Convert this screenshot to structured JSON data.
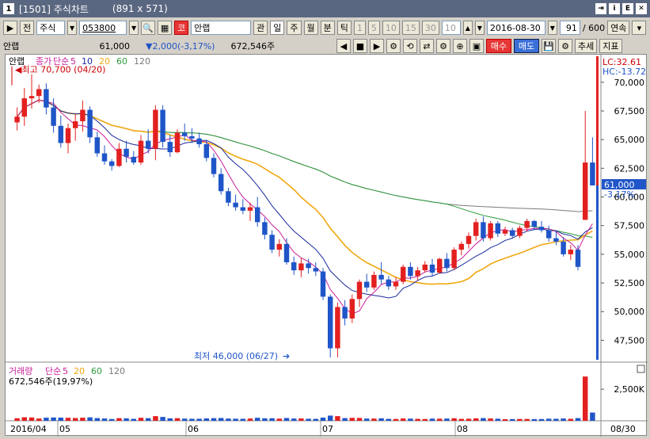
{
  "window": {
    "number": "1",
    "title": "[1501] 주식차트",
    "size": "(891 x 571)"
  },
  "toolbar1": {
    "market_label": "전",
    "market_select": "주식",
    "code": "053800",
    "code_badge": "코",
    "name": "안랩",
    "periods": [
      "관",
      "일",
      "주",
      "월",
      "분",
      "틱"
    ],
    "intervals": [
      "1",
      "5",
      "10",
      "15",
      "30"
    ],
    "interval_value": "10",
    "date": "2016-08-30",
    "count": "91",
    "total": "/ 600",
    "continuous": "연속"
  },
  "toolbar2": {
    "stock_name": "안랩",
    "price": "61,000",
    "change": "▼2,000(-3,17%)",
    "volume": "672,546주",
    "buy": "매수",
    "sell": "매도",
    "trend": "추세",
    "indicator": "지표"
  },
  "price_panel": {
    "legend_name": "안랩",
    "legend_ma": [
      "종가",
      "단순",
      "5",
      "10",
      "20",
      "60",
      "120"
    ],
    "high_marker": "최고 70,700 (04/20)",
    "low_marker": "최저 46,000 (06/27)",
    "lc": "LC:32.61",
    "hc": "HC:-13.72",
    "last_price": "61,000",
    "last_change": "-3.17%"
  },
  "volume_panel": {
    "legend": [
      "거래량",
      "단순",
      "5",
      "20",
      "60",
      "120"
    ],
    "value": "672,546주(19,97%)",
    "axis_label": "2,500K"
  },
  "colors": {
    "up": "#e32020",
    "down": "#1f55c8",
    "ma5": "#c81e9a",
    "ma10": "#1a2a9a",
    "ma20": "#f0a810",
    "ma60": "#2a9a3a",
    "ma120": "#7a7a7a"
  },
  "chart_data": {
    "type": "candlestick",
    "y_ticks": [
      47500,
      50000,
      52500,
      55000,
      57500,
      60000,
      62500,
      65000,
      67500,
      70000
    ],
    "y_labels": [
      "47,500",
      "50,000",
      "52,500",
      "55,000",
      "57,500",
      "60,000",
      "62,500",
      "65,000",
      "67,500",
      "70,000"
    ],
    "ylim": [
      45800,
      71300
    ],
    "x_labels": [
      "2016/04",
      "05",
      "06",
      "07",
      "08",
      "08/30"
    ],
    "candles": [
      [
        66500,
        67800,
        65800,
        67000
      ],
      [
        67000,
        69500,
        66200,
        68600
      ],
      [
        68600,
        70700,
        67700,
        68800
      ],
      [
        68800,
        69800,
        68200,
        69400
      ],
      [
        69400,
        69900,
        67200,
        67800
      ],
      [
        67800,
        68600,
        65600,
        66200
      ],
      [
        66200,
        67100,
        64300,
        64700
      ],
      [
        64700,
        66400,
        63800,
        66000
      ],
      [
        66000,
        67200,
        64900,
        66600
      ],
      [
        66600,
        68400,
        65700,
        67600
      ],
      [
        67600,
        67900,
        64700,
        65200
      ],
      [
        65200,
        65700,
        63500,
        63800
      ],
      [
        63800,
        64500,
        62800,
        63100
      ],
      [
        63100,
        63300,
        62300,
        62700
      ],
      [
        62700,
        64700,
        62600,
        64200
      ],
      [
        64200,
        64900,
        63000,
        63500
      ],
      [
        63500,
        64000,
        62800,
        63000
      ],
      [
        63000,
        65400,
        62800,
        64900
      ],
      [
        64900,
        65900,
        63800,
        64200
      ],
      [
        64200,
        68000,
        63200,
        67600
      ],
      [
        67600,
        68000,
        64300,
        64800
      ],
      [
        64800,
        65400,
        63500,
        63900
      ],
      [
        63900,
        65900,
        63800,
        65600
      ],
      [
        65600,
        66400,
        64900,
        65300
      ],
      [
        65300,
        66000,
        64700,
        65100
      ],
      [
        65100,
        65600,
        64300,
        64600
      ],
      [
        64600,
        64900,
        63100,
        63400
      ],
      [
        63400,
        63800,
        61700,
        62000
      ],
      [
        62000,
        62500,
        60200,
        60500
      ],
      [
        60500,
        60800,
        59200,
        59500
      ],
      [
        59500,
        60200,
        58800,
        59100
      ],
      [
        59100,
        59800,
        58500,
        58800
      ],
      [
        58800,
        59500,
        57900,
        59100
      ],
      [
        59100,
        60000,
        57400,
        57800
      ],
      [
        57800,
        58200,
        56300,
        56700
      ],
      [
        56700,
        57100,
        55100,
        55400
      ],
      [
        55400,
        56300,
        54800,
        55900
      ],
      [
        55900,
        56400,
        54100,
        54300
      ],
      [
        54300,
        54800,
        53200,
        53600
      ],
      [
        53600,
        54700,
        53000,
        54200
      ],
      [
        54200,
        54600,
        53300,
        53800
      ],
      [
        53800,
        54300,
        53100,
        53500
      ],
      [
        53500,
        53800,
        51000,
        51300
      ],
      [
        51300,
        51500,
        46000,
        46800
      ],
      [
        46800,
        50800,
        46000,
        50400
      ],
      [
        50400,
        51000,
        48800,
        49400
      ],
      [
        49400,
        51500,
        49000,
        51100
      ],
      [
        51100,
        52800,
        50400,
        52600
      ],
      [
        52600,
        53300,
        51700,
        52100
      ],
      [
        52100,
        53500,
        51900,
        53200
      ],
      [
        53200,
        54300,
        52400,
        52800
      ],
      [
        52800,
        53100,
        51900,
        52200
      ],
      [
        52200,
        53000,
        51900,
        52600
      ],
      [
        52600,
        54100,
        52400,
        53900
      ],
      [
        53900,
        54300,
        52800,
        53100
      ],
      [
        53100,
        53900,
        52700,
        53600
      ],
      [
        53600,
        54400,
        53400,
        54100
      ],
      [
        54100,
        54600,
        53100,
        53400
      ],
      [
        53400,
        54700,
        53300,
        54600
      ],
      [
        54600,
        55100,
        53500,
        53800
      ],
      [
        53800,
        55600,
        53600,
        55400
      ],
      [
        55400,
        56100,
        54900,
        55900
      ],
      [
        55900,
        56900,
        55500,
        56600
      ],
      [
        56600,
        58100,
        56200,
        57800
      ],
      [
        57800,
        58300,
        56100,
        56400
      ],
      [
        56400,
        57900,
        56200,
        57700
      ],
      [
        57700,
        57900,
        56500,
        56800
      ],
      [
        56800,
        57400,
        56600,
        57100
      ],
      [
        57100,
        57300,
        56400,
        56600
      ],
      [
        56600,
        57500,
        56400,
        57300
      ],
      [
        57300,
        58100,
        57000,
        57900
      ],
      [
        57900,
        58000,
        57100,
        57400
      ],
      [
        57400,
        57900,
        56900,
        57100
      ],
      [
        57100,
        57500,
        56100,
        56400
      ],
      [
        56400,
        57100,
        55800,
        56100
      ],
      [
        56100,
        56500,
        54800,
        55000
      ],
      [
        55000,
        55800,
        54500,
        55400
      ],
      [
        55400,
        55800,
        53600,
        53900
      ],
      [
        58000,
        67500,
        58000,
        63000
      ],
      [
        63000,
        65200,
        62000,
        61000
      ]
    ],
    "volume_label_value": 2500000,
    "vol_ylim": [
      0,
      4200000
    ]
  }
}
